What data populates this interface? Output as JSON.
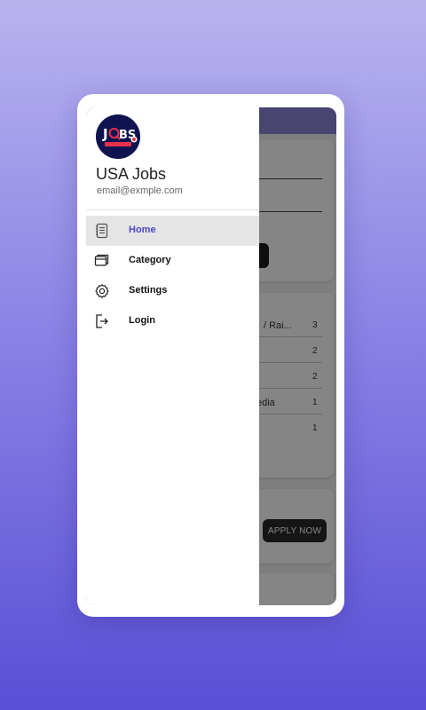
{
  "drawer": {
    "logo": {
      "text": "JOBS",
      "subtitle": "USA JOBS"
    },
    "title": "USA Jobs",
    "email": "email@exmple.com",
    "menu": [
      {
        "label": "Home",
        "icon": "document-list-icon",
        "active": true
      },
      {
        "label": "Category",
        "icon": "folders-icon",
        "active": false
      },
      {
        "label": "Settings",
        "icon": "gear-icon",
        "active": false
      },
      {
        "label": "Login",
        "icon": "login-icon",
        "active": false
      }
    ]
  },
  "background": {
    "category_rows": [
      {
        "label": "/ Rai...",
        "count": "3"
      },
      {
        "label": "",
        "count": "2"
      },
      {
        "label": "",
        "count": "2"
      },
      {
        "label": "edia",
        "count": "1"
      },
      {
        "label": "",
        "count": "1"
      }
    ],
    "apply_label": "APPLY NOW"
  },
  "colors": {
    "accent": "#4f46c8",
    "logo_bg": "#0f1450",
    "scrim": "rgba(0,0,0,0.48)"
  }
}
